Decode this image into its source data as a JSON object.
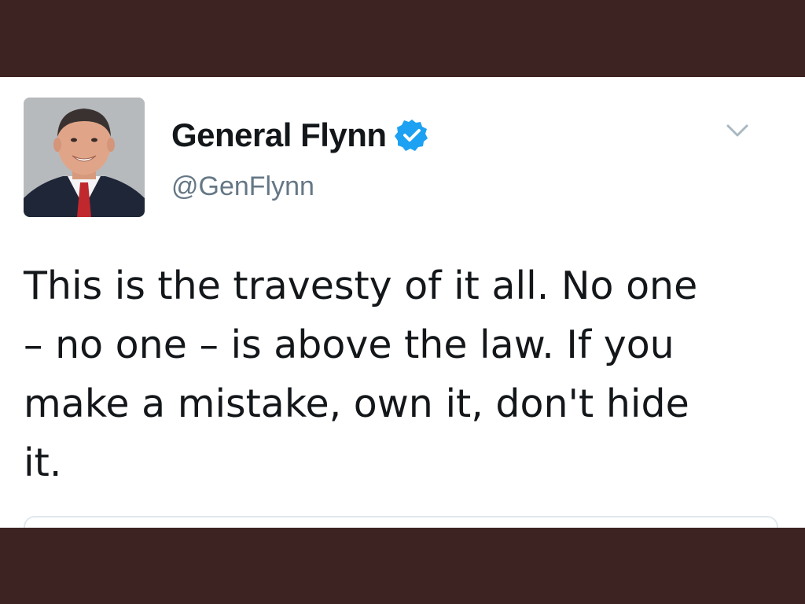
{
  "tweet": {
    "author": {
      "display_name": "General Flynn",
      "handle": "@GenFlynn",
      "verified": true
    },
    "text": "This is the travesty of it all. No one\n– no one – is above the law. If you\nmake a mistake, own it, don't hide\nit."
  },
  "colors": {
    "frame": "#3d2422",
    "verified_blue": "#1da1f2",
    "text": "#14171a",
    "secondary_text": "#657786"
  },
  "icons": {
    "verified": "verified-badge-icon",
    "menu": "chevron-down-icon"
  }
}
